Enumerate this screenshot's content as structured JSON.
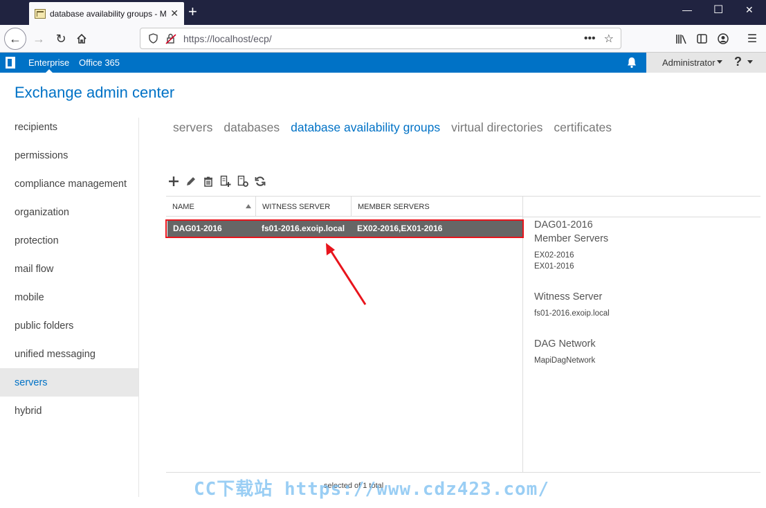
{
  "browser": {
    "tab_title": "database availability groups - M",
    "url": "https://localhost/ecp/"
  },
  "o365": {
    "enterprise": "Enterprise",
    "office365": "Office 365",
    "user": "Administrator",
    "help": "?"
  },
  "app": {
    "title": "Exchange admin center"
  },
  "nav": {
    "items": [
      {
        "label": "recipients"
      },
      {
        "label": "permissions"
      },
      {
        "label": "compliance management"
      },
      {
        "label": "organization"
      },
      {
        "label": "protection"
      },
      {
        "label": "mail flow"
      },
      {
        "label": "mobile"
      },
      {
        "label": "public folders"
      },
      {
        "label": "unified messaging"
      },
      {
        "label": "servers",
        "selected": true
      },
      {
        "label": "hybrid"
      }
    ]
  },
  "subtabs": [
    {
      "label": "servers"
    },
    {
      "label": "databases"
    },
    {
      "label": "database availability groups",
      "active": true
    },
    {
      "label": "virtual directories"
    },
    {
      "label": "certificates"
    }
  ],
  "grid": {
    "columns": [
      "NAME",
      "WITNESS SERVER",
      "MEMBER SERVERS"
    ],
    "rows": [
      {
        "name": "DAG01-2016",
        "witness": "fs01-2016.exoip.local",
        "members": "EX02-2016,EX01-2016"
      }
    ]
  },
  "details": {
    "name": "DAG01-2016",
    "member_servers_label": "Member Servers",
    "members": [
      "EX02-2016",
      "EX01-2016"
    ],
    "witness_label": "Witness Server",
    "witness": "fs01-2016.exoip.local",
    "network_label": "DAG Network",
    "network": "MapiDagNetwork"
  },
  "status": "selected of 1 total",
  "watermark": "CC下载站 https://www.cdz423.com/",
  "colors": {
    "brand": "#0072c6",
    "highlight": "#e8141c",
    "selected_row": "#666666"
  }
}
